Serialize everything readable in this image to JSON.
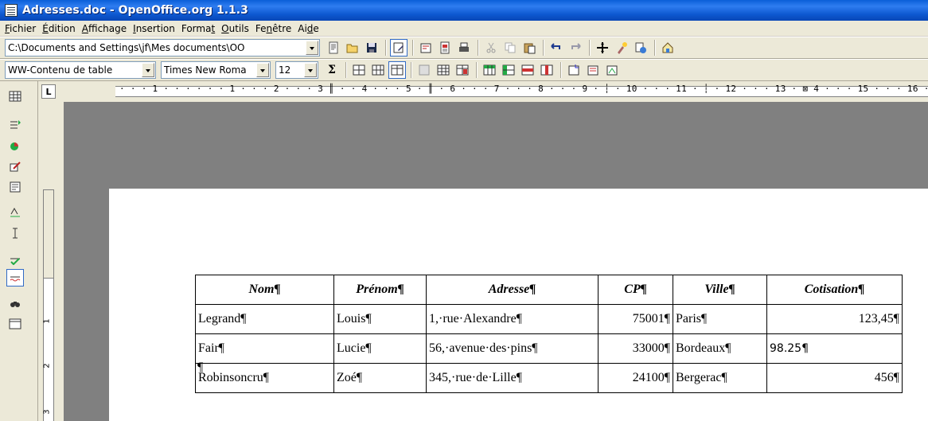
{
  "window": {
    "title": "Adresses.doc - OpenOffice.org 1.1.3"
  },
  "menu": [
    {
      "pre": "",
      "u": "F",
      "post": "ichier"
    },
    {
      "pre": "",
      "u": "É",
      "post": "dition"
    },
    {
      "pre": "",
      "u": "A",
      "post": "ffichage"
    },
    {
      "pre": "",
      "u": "I",
      "post": "nsertion"
    },
    {
      "pre": "Forma",
      "u": "t",
      "post": ""
    },
    {
      "pre": "",
      "u": "O",
      "post": "utils"
    },
    {
      "pre": "Fe",
      "u": "n",
      "post": "être"
    },
    {
      "pre": "Ai",
      "u": "d",
      "post": "e"
    }
  ],
  "toolbar": {
    "path": "C:\\Documents and Settings\\jf\\Mes documents\\OO",
    "style": "WW-Contenu de table",
    "font": "Times New Roma",
    "size": "12",
    "sigma": "Σ"
  },
  "ruler": {
    "corner": "L",
    "ticks": "· · · 1 · · ·   · · · 1 · · · 2 · · · 3 ║ · · 4 · · · 5 ·  ║ · 6 · · · 7 · · · 8 · · · 9 · ┆ · 10 · · · 11 · ┆ · 12 · · · 13 · ⊠ 4 · · · 15 · · · 16 · · · 17 ·",
    "v": [
      "1",
      "2",
      "3"
    ]
  },
  "table": {
    "headers": [
      "Nom¶",
      "Prénom¶",
      "Adresse¶",
      "CP¶",
      "Ville¶",
      "Cotisation¶"
    ],
    "rows": [
      [
        "Legrand¶",
        "Louis¶",
        "1,·rue·Alexandre¶",
        "75001¶",
        "Paris¶",
        "123,45¶"
      ],
      [
        "Fair¶",
        "Lucie¶",
        "56,·avenue·des·pins¶",
        "33000¶",
        "Bordeaux¶",
        "98.25¶"
      ],
      [
        "Robinsoncru¶",
        "Zoé¶",
        "345,·rue·de·Lille¶",
        "24100¶",
        "Bergerac¶",
        "456¶"
      ]
    ],
    "after": "¶"
  },
  "icons": {
    "top": [
      "edit-file-icon",
      "open-folder-icon",
      "save-icon",
      "edit-mode-icon",
      "export-pdf-icon",
      "print-direct-icon",
      "print-icon",
      "cut-icon",
      "copy-icon",
      "paste-icon",
      "undo-icon",
      "redo-icon",
      "navigator-icon",
      "stylist-icon",
      "hyperlink-icon",
      "gallery-icon"
    ],
    "table": [
      "merge-cells-icon",
      "split-cells-icon",
      "optimize-icon",
      "borders-icon",
      "insert-row-icon",
      "insert-column-icon",
      "delete-row-icon",
      "delete-column-icon",
      "table-properties-icon",
      "autoformat-icon",
      "sort-icon"
    ],
    "left": [
      "insert-table-icon",
      "insert-fields-icon",
      "insert-object-icon",
      "edit-icon",
      "text-box-icon",
      "spellcheck-icon",
      "text-cursor-icon",
      "spelling-icon",
      "autospell-icon",
      "find-replace-icon",
      "data-sources-icon"
    ]
  }
}
